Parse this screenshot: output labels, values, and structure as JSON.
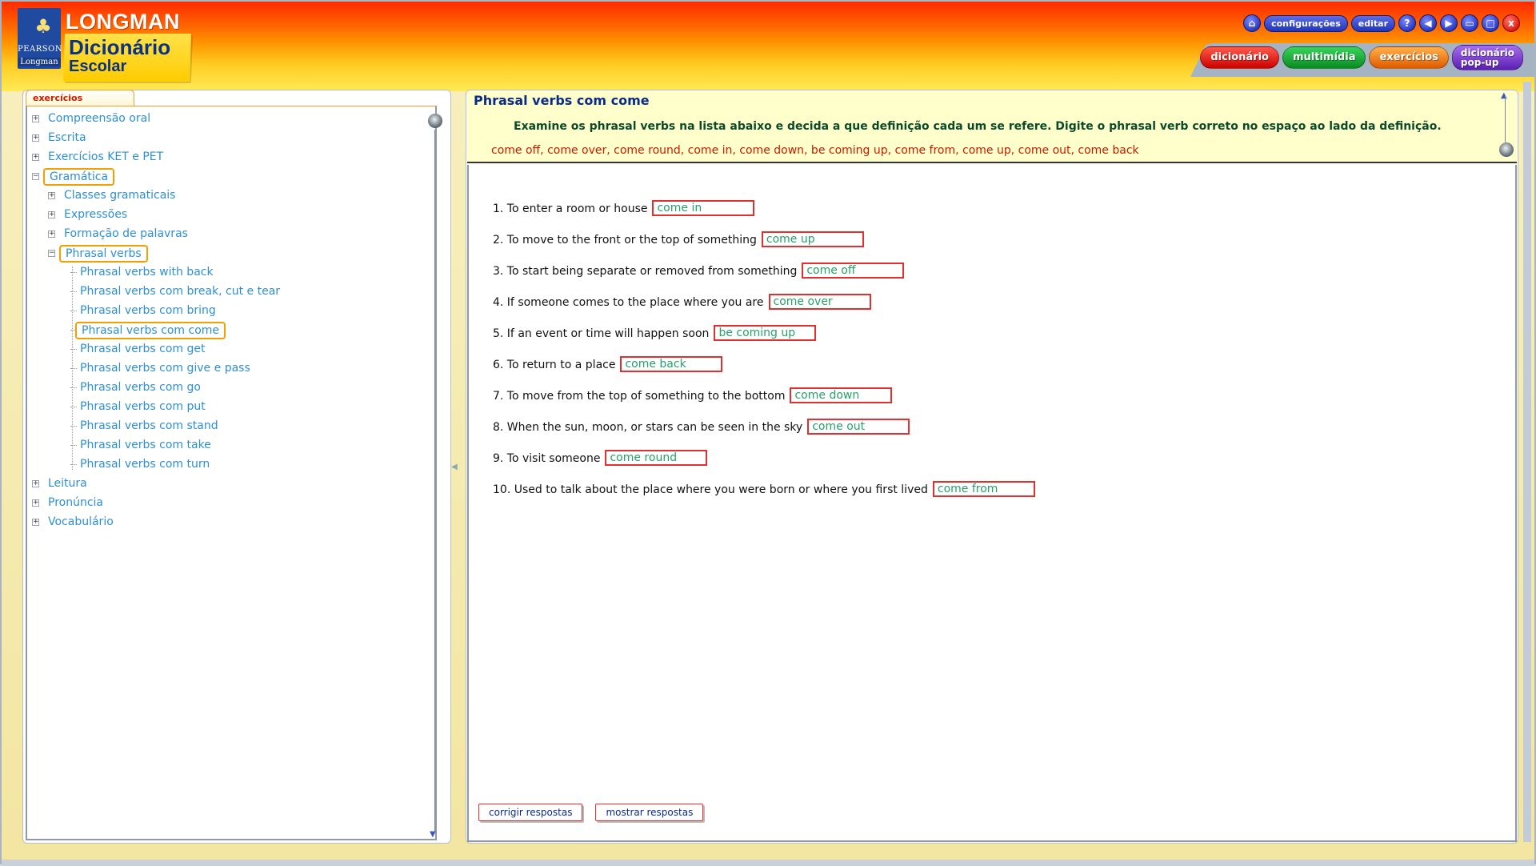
{
  "header": {
    "brand": "LONGMAN",
    "pearson": "PEARSON",
    "pearson_longman": "Longman",
    "title": "Dicionário",
    "subtitle": "Escolar",
    "top_buttons": {
      "config": "configurações",
      "edit": "editar",
      "help": "?",
      "close": "x"
    },
    "tabs": {
      "dictionary": "dicionário",
      "multimedia": "multimídia",
      "exercises": "exercícios",
      "popup_line1": "dicionário",
      "popup_line2": "pop-up"
    }
  },
  "sidebar": {
    "tab_label": "exercícios",
    "items": [
      {
        "label": "Compreensão oral",
        "level": 0,
        "expanded": false
      },
      {
        "label": "Escrita",
        "level": 0,
        "expanded": false
      },
      {
        "label": "Exercícios KET e PET",
        "level": 0,
        "expanded": false
      },
      {
        "label": "Gramática",
        "level": 0,
        "expanded": true,
        "selected": true
      },
      {
        "label": "Classes gramaticais",
        "level": 1,
        "expanded": false
      },
      {
        "label": "Expressões",
        "level": 1,
        "expanded": false
      },
      {
        "label": "Formação de palavras",
        "level": 1,
        "expanded": false
      },
      {
        "label": "Phrasal verbs",
        "level": 1,
        "expanded": true,
        "selected": true
      },
      {
        "label": "Phrasal verbs with back",
        "level": 2
      },
      {
        "label": "Phrasal verbs com break, cut e tear",
        "level": 2
      },
      {
        "label": "Phrasal verbs com bring",
        "level": 2
      },
      {
        "label": "Phrasal verbs com come",
        "level": 2,
        "selected": true
      },
      {
        "label": "Phrasal verbs com get",
        "level": 2
      },
      {
        "label": "Phrasal verbs com give e pass",
        "level": 2
      },
      {
        "label": "Phrasal verbs com go",
        "level": 2
      },
      {
        "label": "Phrasal verbs com put",
        "level": 2
      },
      {
        "label": "Phrasal verbs com stand",
        "level": 2
      },
      {
        "label": "Phrasal verbs com take",
        "level": 2
      },
      {
        "label": "Phrasal verbs com turn",
        "level": 2
      },
      {
        "label": "Leitura",
        "level": 0,
        "expanded": false
      },
      {
        "label": "Pronúncia",
        "level": 0,
        "expanded": false
      },
      {
        "label": "Vocabulário",
        "level": 0,
        "expanded": false
      }
    ]
  },
  "exercise": {
    "title": "Phrasal verbs com come",
    "instructions": "Examine os phrasal verbs na lista abaixo e decida a que definição cada um se refere. Digite o phrasal verb correto no espaço ao lado da definição.",
    "word_list": "come off, come over, come round, come in, come down, be coming up, come from, come up, come out, come back",
    "questions": [
      {
        "text": "1. To enter a room or house",
        "answer": "come in"
      },
      {
        "text": "2. To move to the front or the top of something",
        "answer": "come up"
      },
      {
        "text": "3. To start being separate or removed from something",
        "answer": "come off"
      },
      {
        "text": "4. If someone comes to the place where you are",
        "answer": "come over"
      },
      {
        "text": "5. If an event or time will happen soon",
        "answer": "be coming up"
      },
      {
        "text": "6. To return to a place",
        "answer": "come back"
      },
      {
        "text": "7. To move from the top of something to the bottom",
        "answer": "come down"
      },
      {
        "text": "8. When the sun, moon, or stars can be seen in the sky",
        "answer": "come out"
      },
      {
        "text": "9. To visit someone",
        "answer": "come round"
      },
      {
        "text": "10. Used to talk about the place where you were born or where you first lived",
        "answer": "come from"
      }
    ],
    "buttons": {
      "check": "corrigir respostas",
      "show": "mostrar respostas"
    }
  }
}
